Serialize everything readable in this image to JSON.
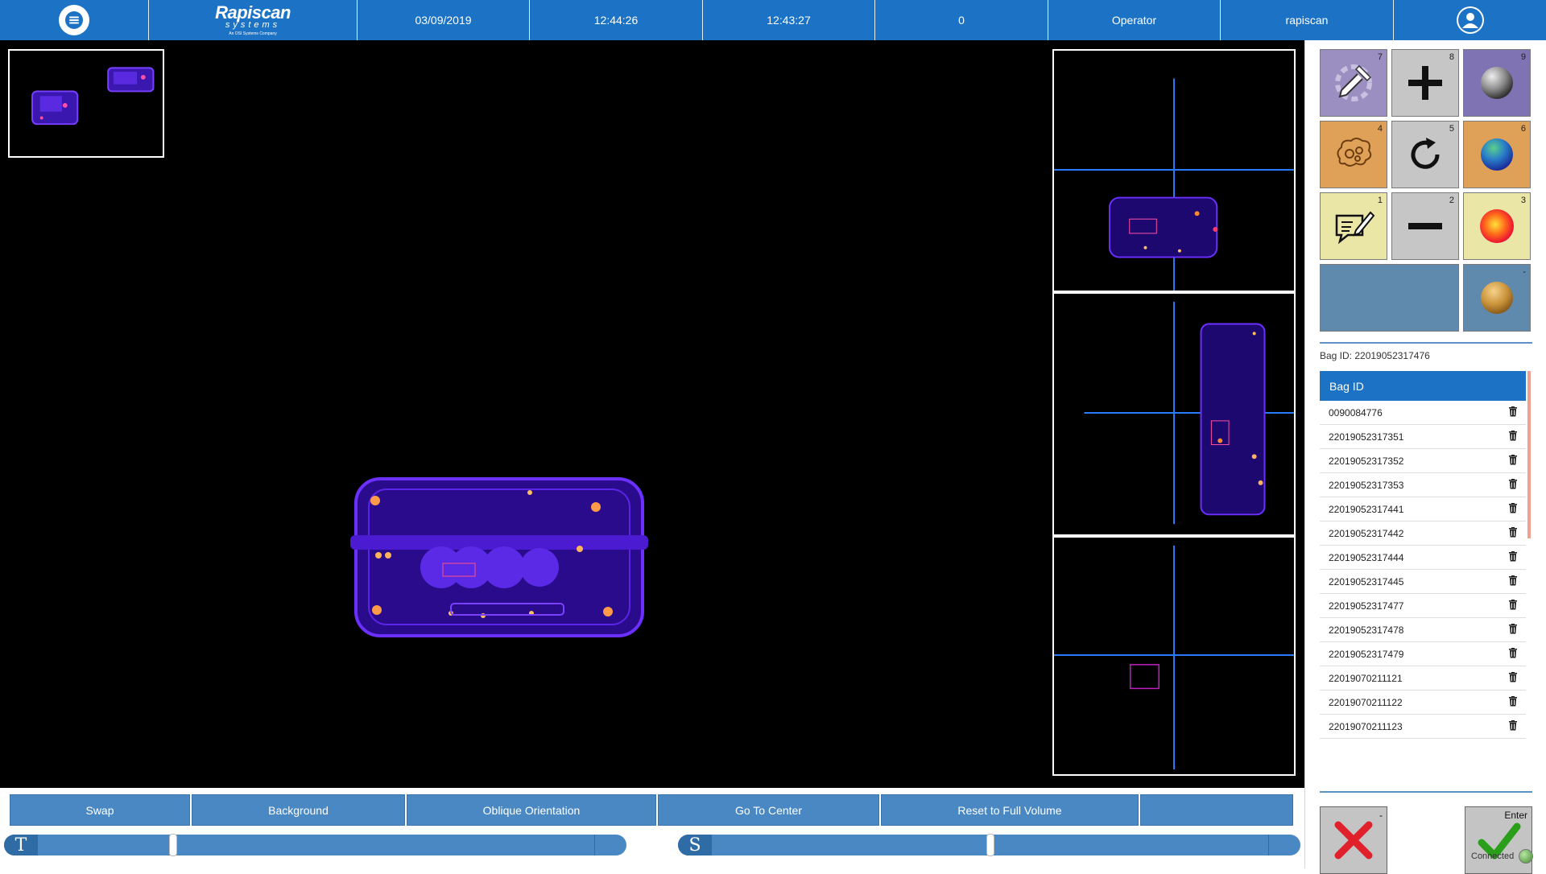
{
  "header": {
    "brand": "Rapiscan",
    "brand_sub": "systems",
    "brand_tag": "An OSI Systems Company",
    "date": "03/09/2019",
    "time_current": "12:44:26",
    "time_start": "12:43:27",
    "count": "0",
    "role": "Operator",
    "user": "rapiscan"
  },
  "toolbar": {
    "buttons": [
      "Swap",
      "Background",
      "Oblique Orientation",
      "Go To Center",
      "Reset to Full Volume",
      ""
    ]
  },
  "sliders": {
    "t_label": "T",
    "t_position": 0.24,
    "s_label": "S",
    "s_position": 0.5
  },
  "tools": [
    {
      "num": "7",
      "icon": "eyedropper-icon",
      "color": "#9a8fc0"
    },
    {
      "num": "8",
      "icon": "plus-icon",
      "color": "#c6c6c6"
    },
    {
      "num": "9",
      "icon": "gray-sphere-icon",
      "color": "#7f73b3"
    },
    {
      "num": "4",
      "icon": "brain-gears-icon",
      "color": "#dfa157"
    },
    {
      "num": "5",
      "icon": "rotate-icon",
      "color": "#c6c6c6"
    },
    {
      "num": "6",
      "icon": "blue-sphere-icon",
      "color": "#dfa157"
    },
    {
      "num": "1",
      "icon": "note-edit-icon",
      "color": "#e9e6a6"
    },
    {
      "num": "2",
      "icon": "minus-icon",
      "color": "#c6c6c6"
    },
    {
      "num": "3",
      "icon": "red-sphere-icon",
      "color": "#e9e6a6"
    },
    {
      "num": "",
      "icon": "blank-tile",
      "color": "#5f89ad"
    },
    {
      "num": "-",
      "icon": "gold-sphere-icon",
      "color": "#5f89ad"
    }
  ],
  "bag": {
    "current_label": "Bag ID: 22019052317476",
    "table_header": "Bag ID",
    "rows": [
      "0090084776",
      "22019052317351",
      "22019052317352",
      "22019052317353",
      "22019052317441",
      "22019052317442",
      "22019052317444",
      "22019052317445",
      "22019052317477",
      "22019052317478",
      "22019052317479",
      "22019070211121",
      "22019070211122",
      "22019070211123"
    ]
  },
  "actions": {
    "reject_num": "-",
    "accept_num": "Enter"
  },
  "status": {
    "text": "Connected"
  },
  "colors": {
    "header_blue": "#1c72c4",
    "button_blue": "#4a88c3",
    "bag_purple": "#5a20e6"
  }
}
